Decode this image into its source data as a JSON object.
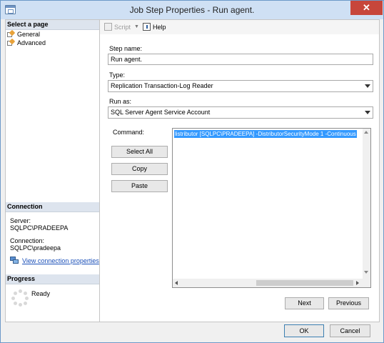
{
  "window": {
    "title": "Job Step Properties - Run agent.",
    "close_glyph": "✕"
  },
  "left_pane": {
    "select_page_header": "Select a page",
    "pages": [
      {
        "label": "General",
        "icon": "wrench-page-icon"
      },
      {
        "label": "Advanced",
        "icon": "wrench-page-icon"
      }
    ],
    "connection_header": "Connection",
    "server_label": "Server:",
    "server_value": "SQLPC\\PRADEEPA",
    "connection_label": "Connection:",
    "connection_value": "SQLPC\\pradeepa",
    "view_connection_link": "View connection properties",
    "progress_header": "Progress",
    "progress_status": "Ready"
  },
  "toolbar": {
    "script_label": "Script",
    "help_label": "Help"
  },
  "form": {
    "step_name_label": "Step name:",
    "step_name_value": "Run agent.",
    "type_label": "Type:",
    "type_value": "Replication Transaction-Log Reader",
    "run_as_label": "Run as:",
    "run_as_value": "SQL Server Agent Service Account",
    "command_label": "Command:",
    "command_value": "listributor [SQLPC\\PRADEEPA] -DistributorSecurityMode 1  -Continuous",
    "select_all_label": "Select All",
    "copy_label": "Copy",
    "paste_label": "Paste",
    "next_label": "Next",
    "previous_label": "Previous"
  },
  "footer": {
    "ok_label": "OK",
    "cancel_label": "Cancel"
  },
  "colors": {
    "title_bar": "#cfe0f4",
    "close_button": "#c7463b",
    "selection": "#3399ff",
    "link": "#1a4fb8"
  }
}
